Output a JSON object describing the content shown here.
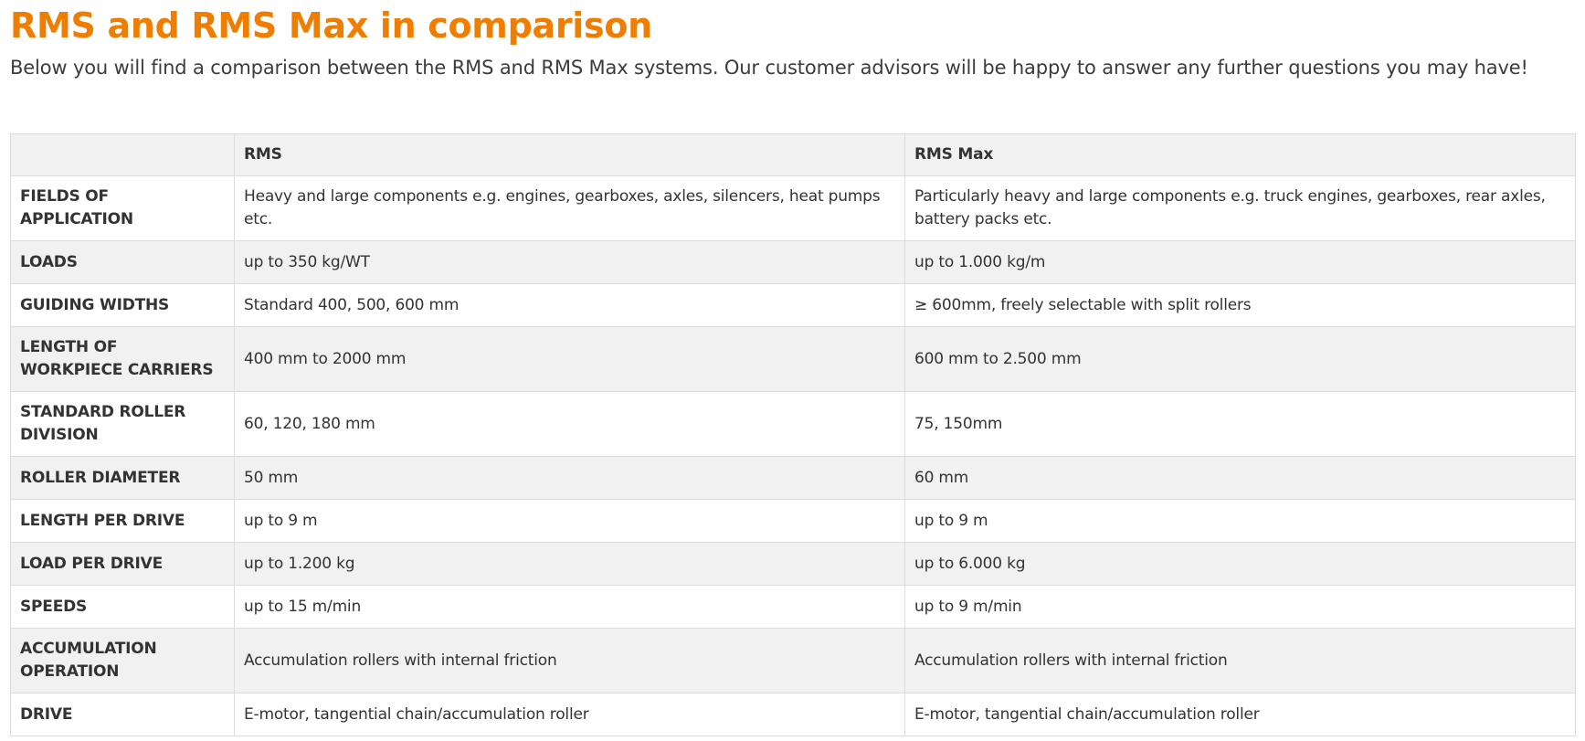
{
  "page": {
    "title": "RMS and RMS Max in comparison",
    "intro": "Below you will find a comparison between the RMS and RMS Max systems. Our customer advisors will be happy to answer any further questions you may have!"
  },
  "colors": {
    "title_accent": "#ef7d00",
    "row_shade": "#f0f1f0",
    "border": "#dcdcdc"
  },
  "table": {
    "headers": [
      "",
      "RMS",
      "RMS Max"
    ],
    "rows": [
      {
        "label": "FIELDS OF APPLICATION",
        "rms": "Heavy and large components e.g. engines, gearboxes, axles, silencers, heat pumps etc.",
        "rms_max": "Particularly heavy and large components e.g. truck engines, gearboxes, rear axles, battery packs etc."
      },
      {
        "label": "LOADS",
        "rms": "up to 350 kg/WT",
        "rms_max": "up to 1.000 kg/m"
      },
      {
        "label": "GUIDING WIDTHS",
        "rms": "Standard 400, 500, 600 mm",
        "rms_max": "≥ 600mm, freely selectable with split rollers"
      },
      {
        "label": "LENGTH OF WORKPIECE CARRIERS",
        "rms": "400 mm to 2000 mm",
        "rms_max": "600 mm to 2.500 mm"
      },
      {
        "label": "STANDARD ROLLER DIVISION",
        "rms": "60, 120, 180 mm",
        "rms_max": "75, 150mm"
      },
      {
        "label": "ROLLER DIAMETER",
        "rms": "50 mm",
        "rms_max": "60 mm"
      },
      {
        "label": "LENGTH PER DRIVE",
        "rms": "up to 9 m",
        "rms_max": "up to 9 m"
      },
      {
        "label": "LOAD PER DRIVE",
        "rms": "up to 1.200 kg",
        "rms_max": "up to 6.000 kg"
      },
      {
        "label": "SPEEDS",
        "rms": "up to 15 m/min",
        "rms_max": "up to 9 m/min"
      },
      {
        "label": "ACCUMULATION OPERATION",
        "rms": "Accumulation rollers with internal friction",
        "rms_max": "Accumulation rollers with internal friction"
      },
      {
        "label": "DRIVE",
        "rms": "E-motor, tangential chain/accumulation roller",
        "rms_max": "E-motor, tangential chain/accumulation roller"
      }
    ]
  }
}
